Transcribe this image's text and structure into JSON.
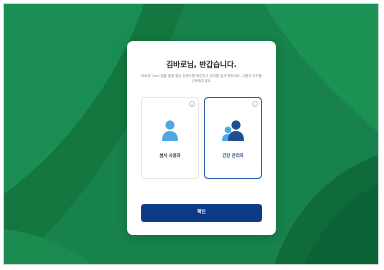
{
  "modal": {
    "title": "김바로님, 반갑습니다.",
    "description": "바로렌 Care 앱을 통해 혈당 트렌드를 확인하고 관리를 쉽게 해보세요. 사용자 모드를 선택해주세요.",
    "options": [
      {
        "label": "센서 사용자",
        "icon": "single-user-icon",
        "selected": false,
        "info_icon": "info-icon"
      },
      {
        "label": "간강 관리자",
        "icon": "two-users-icon",
        "selected": true,
        "info_icon": "info-icon"
      }
    ],
    "confirm_label": "확인"
  },
  "colors": {
    "background": "#17824b",
    "accent": "#0d3a86",
    "selected_border": "#2b5aa6",
    "icon_dark": "#1f4e8f",
    "icon_light": "#4fa8e3"
  }
}
